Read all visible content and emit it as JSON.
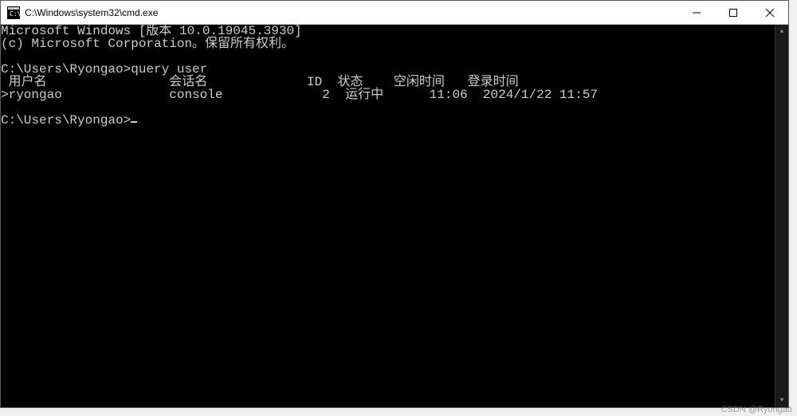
{
  "titlebar": {
    "title": "C:\\Windows\\system32\\cmd.exe"
  },
  "terminal": {
    "banner_line1": "Microsoft Windows [版本 10.0.19045.3930]",
    "banner_line2": "(c) Microsoft Corporation。保留所有权利。",
    "prompt1": "C:\\Users\\Ryongao>",
    "command1": "query user",
    "header_line": " 用户名                会话名             ID  状态    空闲时间   登录时间",
    "data_line": ">ryongao              console             2  运行中      11:06  2024/1/22 11:57",
    "prompt2": "C:\\Users\\Ryongao>"
  },
  "watermark": "CSDN @Ryongao"
}
